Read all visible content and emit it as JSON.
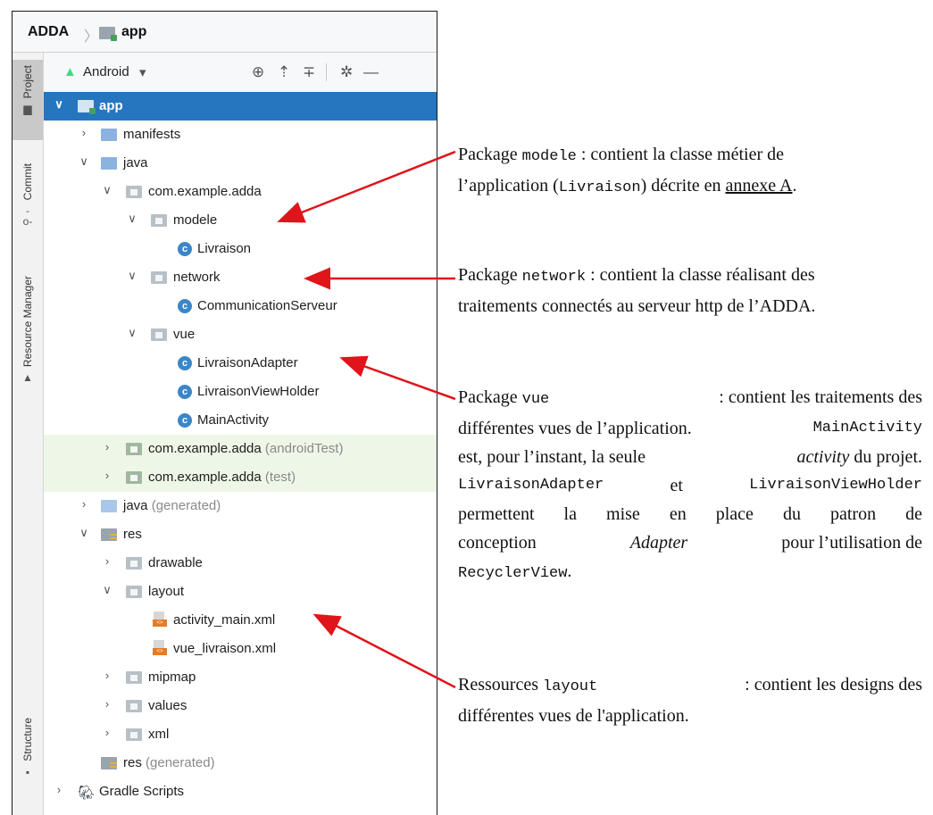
{
  "breadcrumb": {
    "project": "ADDA",
    "separator": "〉",
    "module": "app"
  },
  "sidebar": {
    "tabs": [
      {
        "label": "Project",
        "icon": "folder-icon"
      },
      {
        "label": "Commit",
        "icon": "commit-icon"
      },
      {
        "label": "Resource Manager",
        "icon": "resource-icon"
      },
      {
        "label": "Structure",
        "icon": "structure-icon"
      }
    ]
  },
  "toolbar": {
    "view_label": "Android",
    "dropdown_icon": "▾"
  },
  "tree": {
    "app": "app",
    "manifests": "manifests",
    "java": "java",
    "pkg_main": "com.example.adda",
    "modele": "modele",
    "livraison": "Livraison",
    "network": "network",
    "communication": "CommunicationServeur",
    "vue": "vue",
    "livraison_adapter": "LivraisonAdapter",
    "livraison_viewholder": "LivraisonViewHolder",
    "main_activity": "MainActivity",
    "pkg_android_test": "com.example.adda",
    "pkg_android_test_sfx": " (androidTest)",
    "pkg_test": "com.example.adda",
    "pkg_test_sfx": " (test)",
    "java_gen": "java",
    "java_gen_sfx": " (generated)",
    "res": "res",
    "drawable": "drawable",
    "layout": "layout",
    "activity_main": "activity_main.xml",
    "vue_livraison": "vue_livraison.xml",
    "mipmap": "mipmap",
    "values": "values",
    "xml": "xml",
    "res_gen": "res",
    "res_gen_sfx": " (generated)",
    "gradle": "Gradle Scripts",
    "class_badge": "c"
  },
  "annotations": {
    "a1": {
      "l1_a": "Package ",
      "l1_code": "modele",
      "l1_b": " : contient la classe métier de",
      "l2_a": "l’application (",
      "l2_code": "Livraison",
      "l2_b": ") décrite en ",
      "l2_link": "annexe A",
      "l2_c": "."
    },
    "a2": {
      "l1_a": "Package ",
      "l1_code": "network",
      "l1_b": " : contient la classe réalisant des",
      "l2": "traitements connectés au serveur http de l’ADDA."
    },
    "a3": {
      "l1_a": "Package ",
      "l1_code": "vue",
      "l1_b": " : contient les traitements des",
      "l2": "différentes vues de l’application.",
      "l2_code": "MainActivity",
      "l3_a": "est, pour l’instant, la seule ",
      "l3_it": "activity",
      "l3_b": " du projet.",
      "l4_code1": "LivraisonAdapter",
      "l4_mid": "et",
      "l4_code2": "LivraisonViewHolder",
      "l5": "permettent la mise en place du patron de",
      "l6_a": "conception ",
      "l6_it": "Adapter",
      "l6_b": " pour l’utilisation de",
      "l7_code": "RecyclerView",
      "l7_b": "."
    },
    "a4": {
      "l1_a": "Ressources ",
      "l1_code": "layout",
      "l1_b": " : contient les designs des",
      "l2": "différentes vues de l'application."
    }
  },
  "colors": {
    "selection": "#2675bf",
    "arrow": "#e0141b",
    "green_row": "#eef7e7"
  }
}
